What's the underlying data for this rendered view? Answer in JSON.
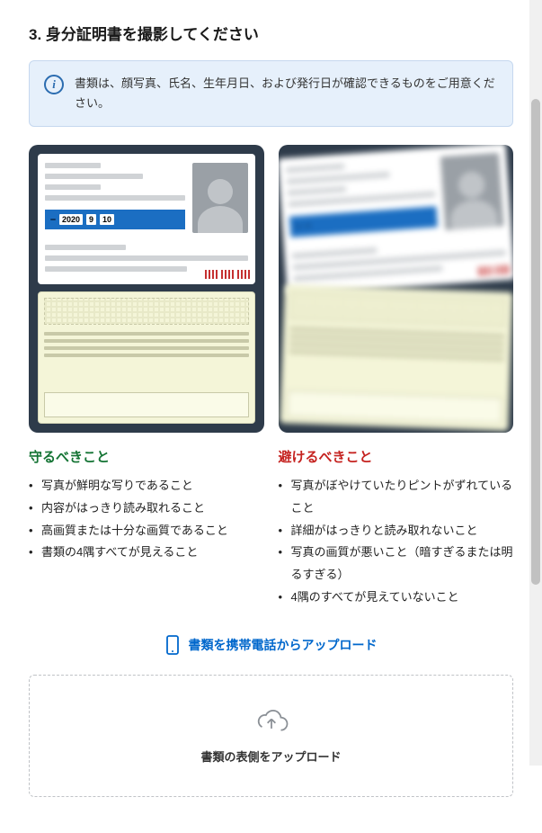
{
  "heading": "3. 身分証明書を撮影してください",
  "info": "書類は、顔写真、氏名、生年月日、および発行日が確認できるものをご用意ください。",
  "card_date": {
    "year": "2020",
    "month": "9",
    "day": "10"
  },
  "do": {
    "title": "守るべきこと",
    "items": [
      "写真が鮮明な写りであること",
      "内容がはっきり読み取れること",
      "高画質または十分な画質であること",
      "書類の4隅すべてが見えること"
    ]
  },
  "dont": {
    "title": "避けるべきこと",
    "items": [
      "写真がぼやけていたりピントがずれていること",
      "詳細がはっきりと読み取れないこと",
      "写真の画質が悪いこと（暗すぎるまたは明るすぎる）",
      "4隅のすべてが見えていないこと"
    ]
  },
  "mobile_link": "書類を携帯電話からアップロード",
  "upload_label": "書類の表側をアップロード"
}
